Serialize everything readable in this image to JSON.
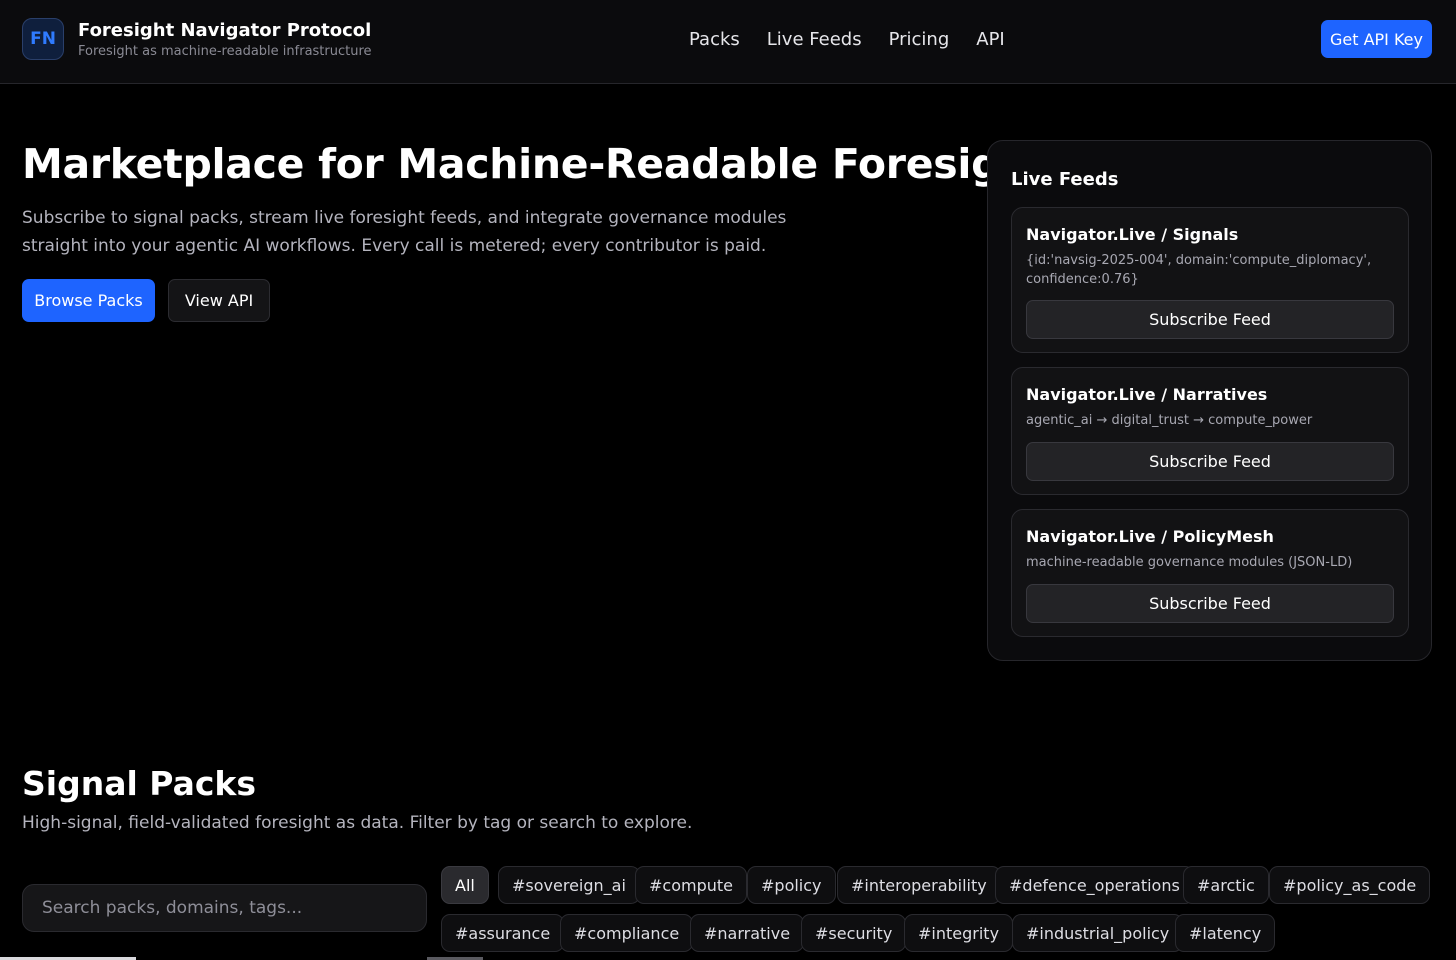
{
  "header": {
    "logo_text": "FN",
    "brand_title": "Foresight Navigator Protocol",
    "brand_tagline": "Foresight as machine-readable infrastructure",
    "nav": [
      "Packs",
      "Live Feeds",
      "Pricing",
      "API"
    ],
    "cta_label": "Get API Key"
  },
  "hero": {
    "title": "Marketplace for Machine-Readable Foresight",
    "description": "Subscribe to signal packs, stream live foresight feeds, and integrate governance modules straight into your agentic AI workflows. Every call is metered; every contributor is paid.",
    "primary_label": "Browse Packs",
    "secondary_label": "View API"
  },
  "live_feeds": {
    "heading": "Live Feeds",
    "feeds": [
      {
        "title": "Navigator.Live / Signals",
        "description": "{id:'navsig-2025-004', domain:'compute_diplomacy', confidence:0.76}",
        "button": "Subscribe Feed"
      },
      {
        "title": "Navigator.Live / Narratives",
        "description": "agentic_ai → digital_trust → compute_power",
        "button": "Subscribe Feed"
      },
      {
        "title": "Navigator.Live / PolicyMesh",
        "description": "machine-readable governance modules (JSON-LD)",
        "button": "Subscribe Feed"
      }
    ]
  },
  "signal_packs": {
    "title": "Signal Packs",
    "subtitle": "High-signal, field-validated foresight as data. Filter by tag or search to explore.",
    "search_placeholder": "Search packs, domains, tags...",
    "tags": [
      "All",
      "#sovereign_ai",
      "#compute",
      "#policy",
      "#interoperability",
      "#defence_operations",
      "#arctic",
      "#policy_as_code",
      "#assurance",
      "#compliance",
      "#narrative",
      "#security",
      "#integrity",
      "#industrial_policy",
      "#latency"
    ],
    "active_tag": "All"
  }
}
